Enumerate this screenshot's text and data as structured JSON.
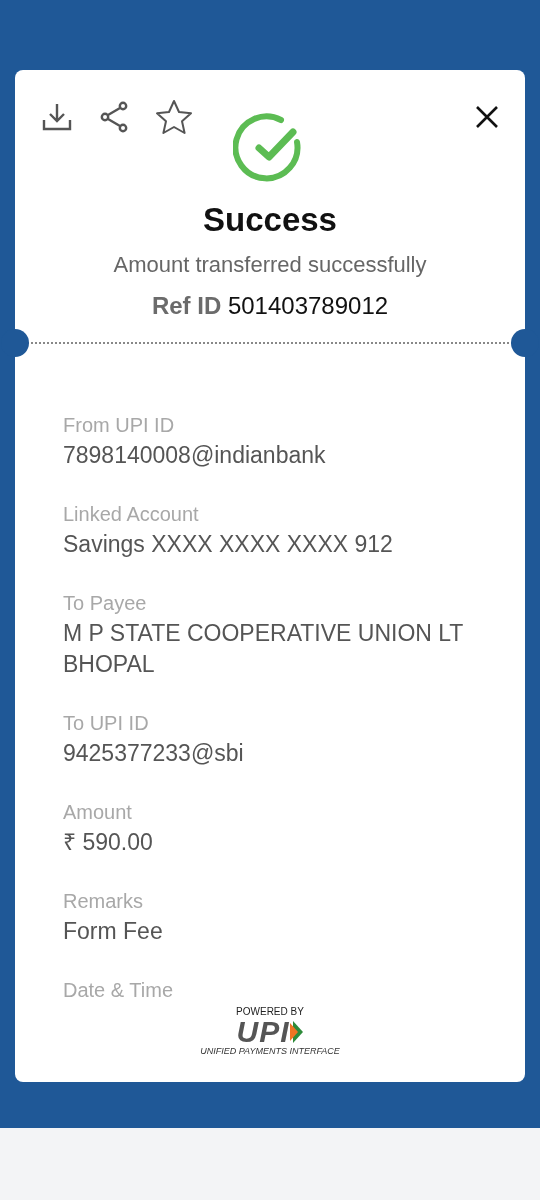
{
  "toolbar": {
    "starred": false
  },
  "result": {
    "kind": "success",
    "title": "Success",
    "message": "Amount transferred successfully",
    "ref_label": "Ref ID",
    "ref_value": "501403789012"
  },
  "fields": [
    {
      "label": "From UPI ID",
      "value": "7898140008@indianbank"
    },
    {
      "label": "Linked Account",
      "value": "Savings XXXX XXXX XXXX 912"
    },
    {
      "label": "To Payee",
      "value": "M P STATE COOPERATIVE UNION LT\nBHOPAL"
    },
    {
      "label": "To UPI ID",
      "value": "9425377233@sbi"
    },
    {
      "label": "Amount",
      "value": "₹ 590.00"
    },
    {
      "label": "Remarks",
      "value": "Form Fee"
    },
    {
      "label": "Date & Time"
    }
  ],
  "footer": {
    "powered_by": "POWERED BY",
    "brand": "UPI",
    "tagline": "UNIFIED PAYMENTS INTERFACE"
  }
}
